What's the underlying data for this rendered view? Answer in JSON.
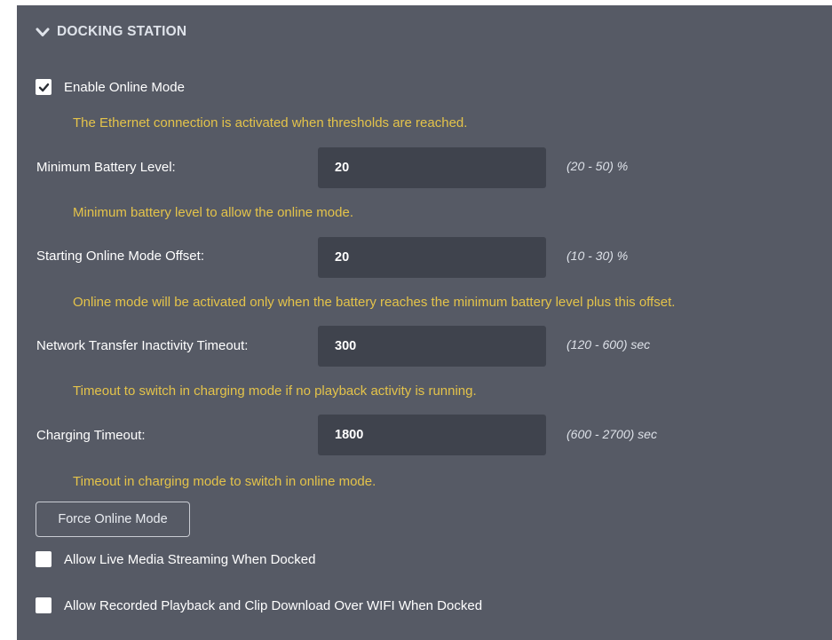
{
  "section": {
    "title": "DOCKING STATION",
    "icon": "chevron-down-icon"
  },
  "enable_online_mode": {
    "label": "Enable Online Mode",
    "checked": true,
    "hint": "The Ethernet connection is activated when thresholds are reached."
  },
  "fields": [
    {
      "label": "Minimum Battery Level:",
      "value": "20",
      "range": "(20 - 50) %",
      "hint": "Minimum battery level to allow the online mode."
    },
    {
      "label": "Starting Online Mode Offset:",
      "value": "20",
      "range": "(10 - 30) %",
      "hint": "Online mode will be activated only when the battery reaches the minimum battery level plus this offset."
    },
    {
      "label": "Network Transfer Inactivity Timeout:",
      "value": "300",
      "range": "(120 - 600) sec",
      "hint": "Timeout to switch in charging mode if no playback activity is running."
    },
    {
      "label": "Charging Timeout:",
      "value": "1800",
      "range": "(600 - 2700) sec",
      "hint": "Timeout in charging mode to switch in online mode."
    }
  ],
  "force_button": {
    "label": "Force Online Mode"
  },
  "allow_live": {
    "label": "Allow Live Media Streaming When Docked",
    "checked": false
  },
  "allow_recorded": {
    "label": "Allow Recorded Playback and Clip Download Over WIFI When Docked",
    "checked": false
  },
  "colors": {
    "panel_bg": "#565a65",
    "input_bg": "#3f434d",
    "hint": "#e4c34a",
    "text": "#ffffff"
  }
}
